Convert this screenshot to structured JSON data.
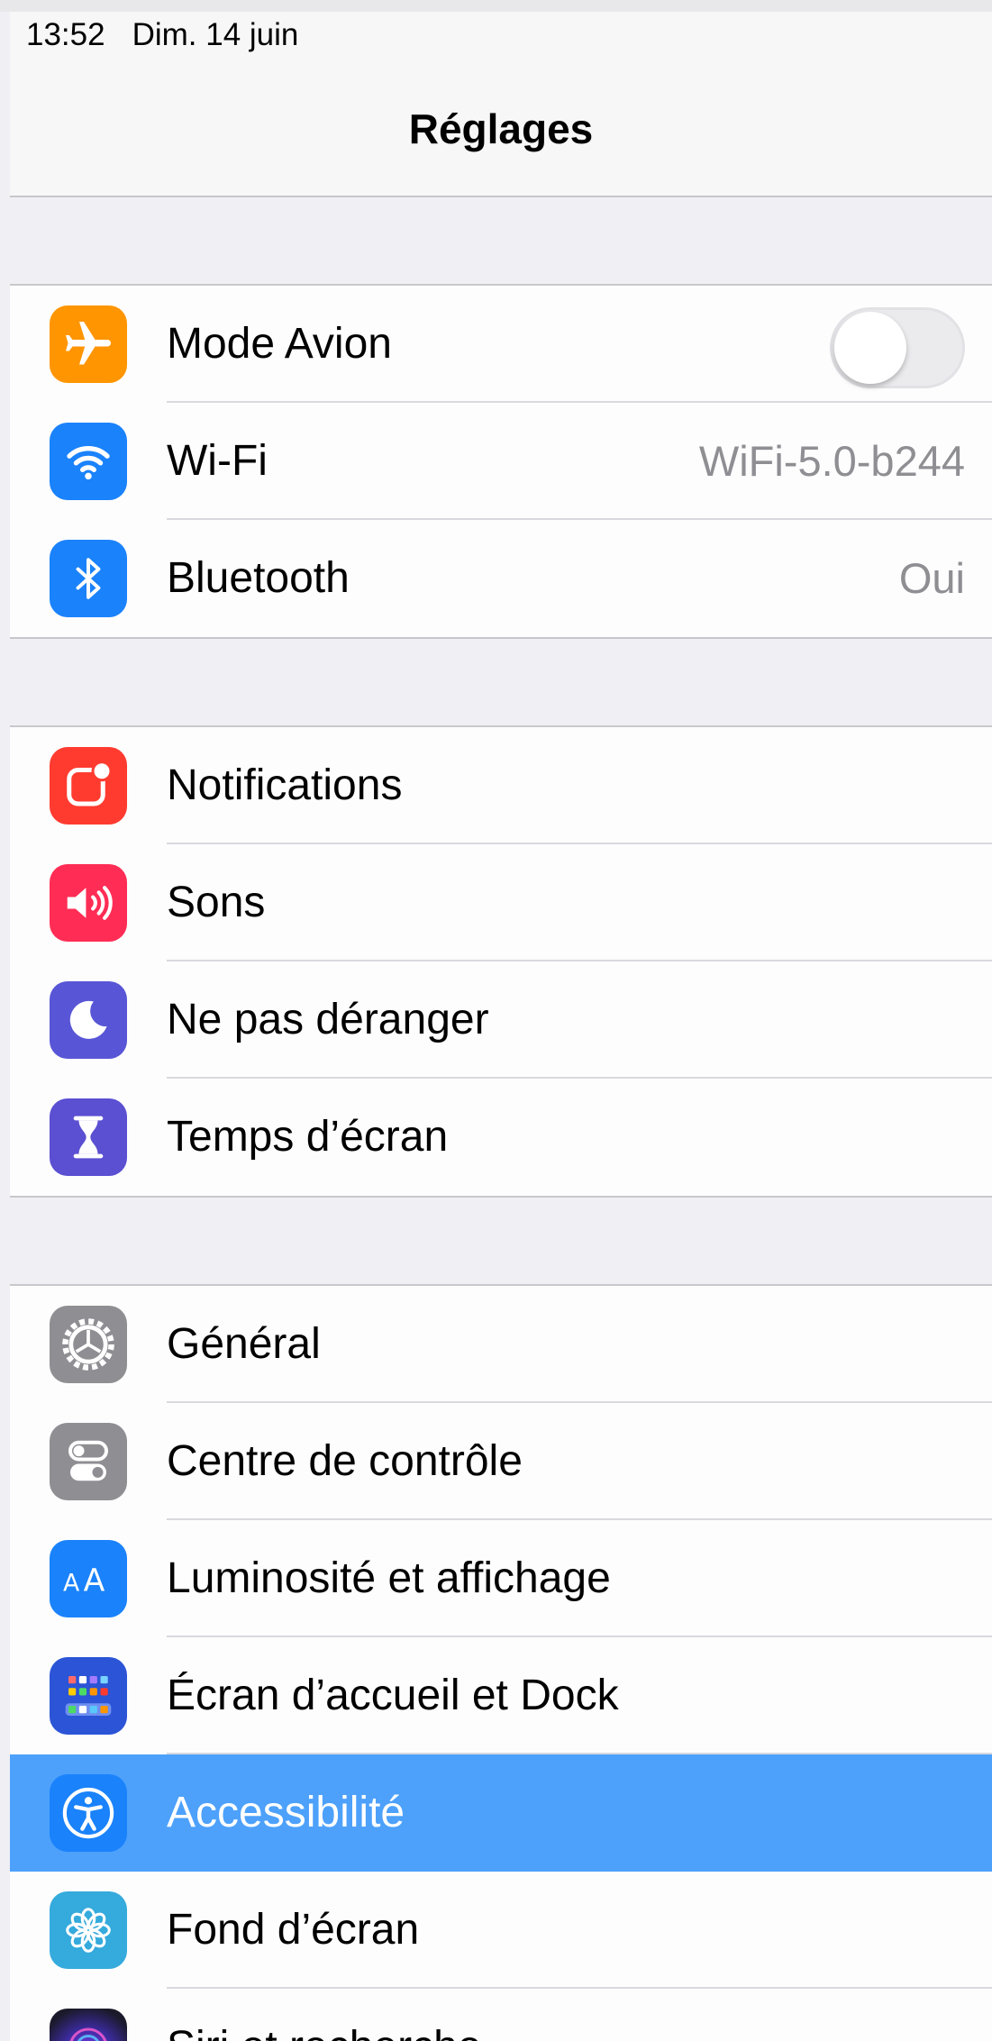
{
  "status_bar": {
    "time": "13:52",
    "date": "Dim. 14 juin"
  },
  "nav": {
    "title": "Réglages"
  },
  "groups": [
    {
      "rows": [
        {
          "label": "Mode Avion",
          "icon": "airplane-icon",
          "icon_color": "#ff9500",
          "accessory": "toggle",
          "toggle_on": false
        },
        {
          "label": "Wi-Fi",
          "icon": "wifi-icon",
          "icon_color": "#1a82fb",
          "value": "WiFi-5.0-b244"
        },
        {
          "label": "Bluetooth",
          "icon": "bluetooth-icon",
          "icon_color": "#1a82fb",
          "value": "Oui"
        }
      ]
    },
    {
      "rows": [
        {
          "label": "Notifications",
          "icon": "notifications-icon",
          "icon_color": "#ff3b30"
        },
        {
          "label": "Sons",
          "icon": "speaker-icon",
          "icon_color": "#ff2d55"
        },
        {
          "label": "Ne pas déranger",
          "icon": "moon-icon",
          "icon_color": "#5856d6"
        },
        {
          "label": "Temps d’écran",
          "icon": "hourglass-icon",
          "icon_color": "#5b4fd2"
        }
      ]
    },
    {
      "rows": [
        {
          "label": "Général",
          "icon": "gear-icon",
          "icon_color": "#8e8e93"
        },
        {
          "label": "Centre de contrôle",
          "icon": "control-center-icon",
          "icon_color": "#8e8e93"
        },
        {
          "label": "Luminosité et affichage",
          "icon": "text-size-icon",
          "icon_color": "#1a82fb"
        },
        {
          "label": "Écran d’accueil et Dock",
          "icon": "home-screen-icon",
          "icon_color": "#2b54d6"
        },
        {
          "label": "Accessibilité",
          "icon": "accessibility-icon",
          "icon_color": "#1a82fb",
          "selected": true
        },
        {
          "label": "Fond d’écran",
          "icon": "wallpaper-icon",
          "icon_color": "#35aadc"
        },
        {
          "label": "Siri et recherche",
          "icon": "siri-icon",
          "icon_color": "#2a2a3a"
        }
      ]
    }
  ],
  "colors": {
    "selection": "#4da1fb",
    "background": "#efeff4"
  }
}
